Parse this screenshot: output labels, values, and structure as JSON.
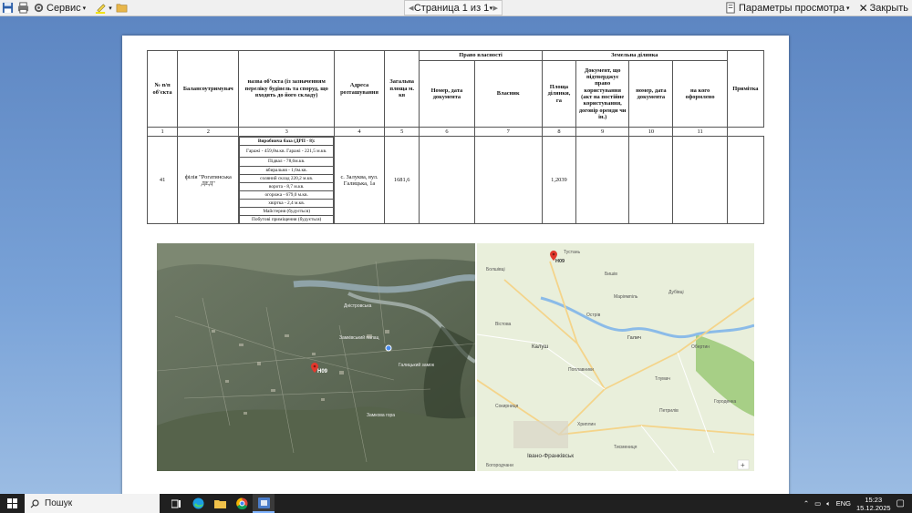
{
  "toolbar": {
    "service_label": "Сервис",
    "page_indicator": "Страница 1 из 1",
    "view_params_label": "Параметры просмотра",
    "close_label": "Закрыть"
  },
  "table": {
    "header": {
      "num": "№ п/п об'єкта",
      "holder": "Балансоутримувач",
      "name": "назва об’єкта (із зазначенням переліку будівель та споруд, що входять до його складу)",
      "address": "Адреса розташування",
      "area": "Загальна площа м. кв",
      "ownership_group": "Право власності",
      "own_doc": "Номер, дата документа",
      "owner": "Власник",
      "land_group": "Земельна ділянка",
      "land_area": "Площа ділянки, га",
      "land_doc": "Документ, що підтверджує право користування (акт на постійне користування, договір оренди чи ін.)",
      "land_doc_num": "номер, дата документа",
      "registered_to": "на кого оформлено",
      "note": "Примітка"
    },
    "col_numbers": [
      "1",
      "2",
      "3",
      "4",
      "5",
      "6",
      "7",
      "8",
      "9",
      "10",
      "11"
    ],
    "row": {
      "num": "41",
      "holder": "філія \"Рогатинська ДЕД\"",
      "objects_title": "Виробнича база (ДРП - 8):",
      "objects": [
        "Гаражі - 459,8м.кв. Гаражі - 221,5 м.кв.",
        "Підвал - 78,6м.кв.",
        "вбиральня - 1,6м.кв.",
        "соляний склад 220,2 м.кв.",
        "ворота - 8,7 м.кв.",
        "огорожа - 679,0 м.кв.",
        "хвіртка - 2,4 м.кв.",
        "Майстерня (будується)",
        "Побутові приміщення (будується)"
      ],
      "address": "с. Залуква, вул. Галицька, 1а",
      "area": "1681,6",
      "own_doc": "",
      "owner": "",
      "land_area": "1,2039",
      "land_doc": "",
      "land_doc_num": "",
      "registered_to": "",
      "note": ""
    }
  },
  "satellite_map": {
    "marker_label": "Н09",
    "labels": [
      "Дністровська",
      "Замківський палац",
      "Галицький замок",
      "Замкова гора"
    ]
  },
  "road_map": {
    "marker_label": "Н09",
    "cities": [
      "Тустань",
      "Бишів",
      "Болшівці",
      "Маріямпіль",
      "Калуш",
      "Вістова",
      "Острів",
      "Поплавники",
      "Галич",
      "Обертин",
      "Тлумач",
      "Городенка",
      "Івано-Франківськ",
      "Тисмениця",
      "Хриплин",
      "Богородчани",
      "Сокирниця",
      "Петрилів",
      "Дубівці"
    ],
    "zoom_label": "+"
  },
  "taskbar": {
    "search_label": "Пошук",
    "language": "ENG",
    "time": "15:23",
    "date": "15.12.2025"
  }
}
